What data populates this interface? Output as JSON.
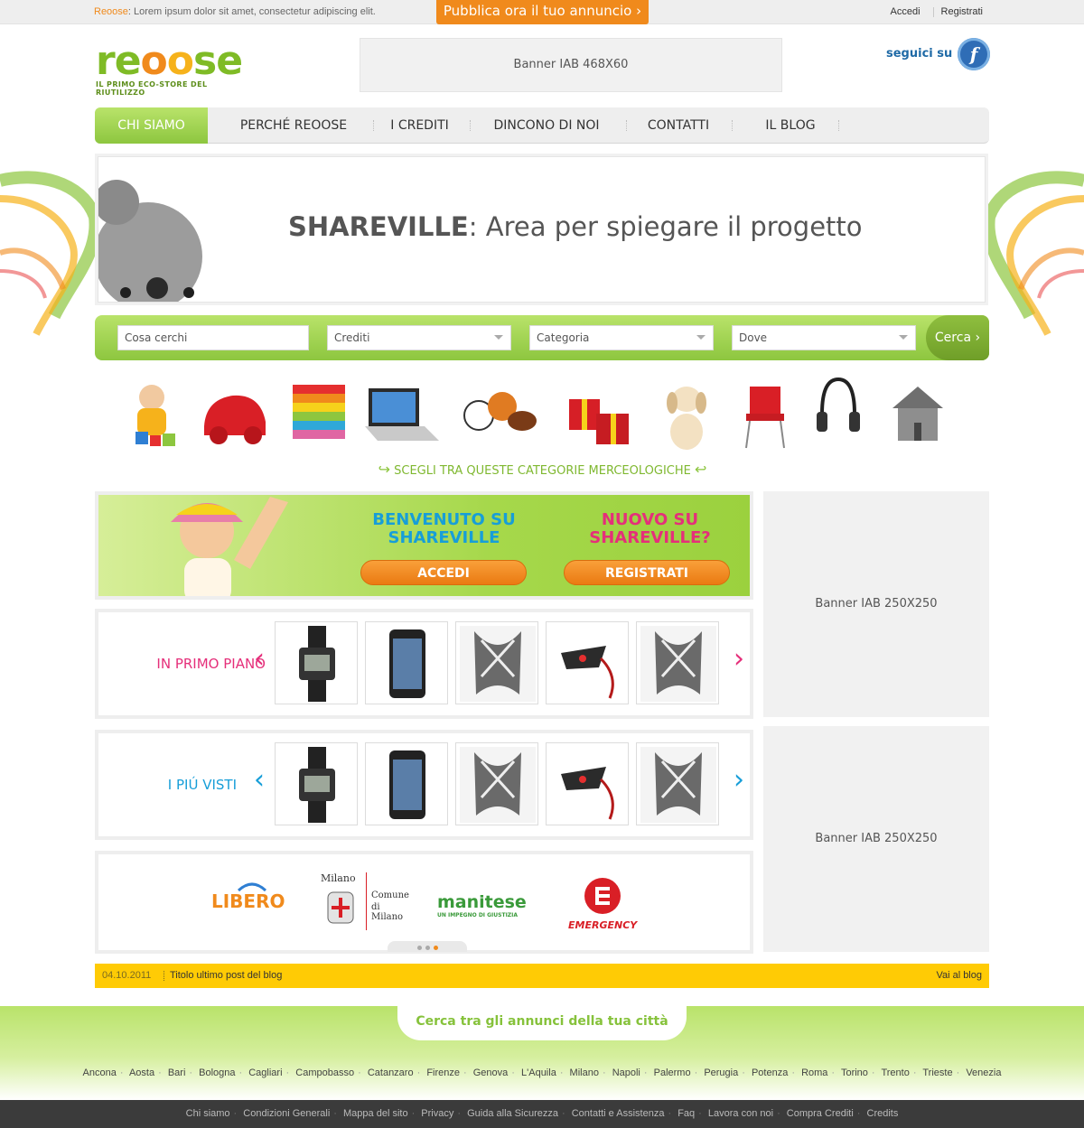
{
  "topbar": {
    "brand": "Reoose",
    "tagline": ": Lorem ipsum dolor sit amet, consectetur adipiscing elit.",
    "publish_label": "Pubblica ora il tuo annuncio ›",
    "login_label": "Accedi",
    "register_label": "Registrati"
  },
  "header": {
    "logo_text": "reoose",
    "logo_sub": "IL PRIMO ECO-STORE DEL RIUTILIZZO",
    "banner_label": "Banner IAB 468X60",
    "follow_label": "seguici su",
    "facebook_letter": "f"
  },
  "nav": {
    "items": [
      {
        "label": "CHI SIAMO",
        "active": true
      },
      {
        "label": "PERCHÉ REOOSE"
      },
      {
        "label": "I CREDITI"
      },
      {
        "label": "DINCONO DI NOI"
      },
      {
        "label": "CONTATTI"
      },
      {
        "label": "IL BLOG"
      }
    ]
  },
  "hero": {
    "title_bold": "SHAREVILLE",
    "title_rest": ": Area per spiegare il progetto"
  },
  "search": {
    "what_placeholder": "Cosa cerchi",
    "credits_value": "Crediti",
    "category_value": "Categoria",
    "where_value": "Dove",
    "button_label": "Cerca ›"
  },
  "categories": {
    "items": [
      "baby-toys",
      "toy-car",
      "clothes",
      "laptop",
      "sports-balls",
      "gifts",
      "puppy",
      "chair",
      "headphones",
      "house"
    ],
    "label": "SCEGLI TRA QUESTE CATEGORIE MERCEOLOGICHE"
  },
  "welcome": {
    "welcome_title": "BENVENUTO SU SHAREVILLE",
    "login_button": "ACCEDI",
    "new_title": "NUOVO SU SHAREVILLE?",
    "register_button": "REGISTRATI"
  },
  "featured": {
    "label": "IN PRIMO PIANO",
    "prev": "‹",
    "next": "›",
    "items": [
      "watch",
      "phone",
      "scarf",
      "device",
      "scarf"
    ]
  },
  "most_viewed": {
    "label": "I PIÚ VISTI",
    "prev": "‹",
    "next": "›",
    "items": [
      "watch",
      "phone",
      "scarf",
      "device",
      "scarf"
    ]
  },
  "partners": {
    "libero": "LIBERO",
    "milano_top": "Milano",
    "milano_line1": "Comune",
    "milano_line2": "di Milano",
    "manitese": "manitese",
    "manitese_sub": "UN IMPEGNO DI GIUSTIZIA",
    "emergency": "EMERGENCY"
  },
  "side_banners": [
    "Banner IAB 250X250",
    "Banner IAB 250X250"
  ],
  "blog": {
    "date": "04.10.2011",
    "title": "Titolo ultimo post del blog",
    "link": "Vai al blog"
  },
  "cities": {
    "title": "Cerca tra gli annunci della tua città",
    "items": [
      "Ancona",
      "Aosta",
      "Bari",
      "Bologna",
      "Cagliari",
      "Campobasso",
      "Catanzaro",
      "Firenze",
      "Genova",
      "L'Aquila",
      "Milano",
      "Napoli",
      "Palermo",
      "Perugia",
      "Potenza",
      "Roma",
      "Torino",
      "Trento",
      "Trieste",
      "Venezia"
    ]
  },
  "footer": {
    "links": [
      "Chi siamo",
      "Condizioni Generali",
      "Mappa del sito",
      "Privacy",
      "Guida alla Sicurezza",
      "Contatti e Assistenza",
      "Faq",
      "Lavora con noi",
      "Compra Crediti",
      "Credits"
    ]
  },
  "colors": {
    "green": "#8dc63f",
    "orange": "#f08a1c",
    "yellow": "#ffcb05",
    "pink": "#e52f7a",
    "blue": "#179ed8"
  }
}
